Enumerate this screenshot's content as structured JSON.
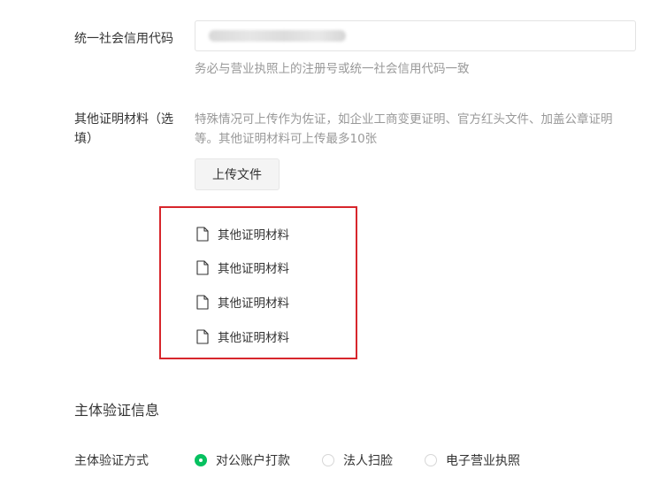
{
  "credit_code": {
    "label": "统一社会信用代码",
    "hint": "务必与营业执照上的注册号或统一社会信用代码一致"
  },
  "other_materials": {
    "label_line1": "其他证明材料（选",
    "label_line2": "填）",
    "hint_line1": "特殊情况可上传作为佐证，如企业工商变更证明、官方红头文件、加盖公章证明",
    "hint_line2": "等。其他证明材料可上传最多10张",
    "upload_button_label": "上传文件",
    "files": [
      {
        "name": "其他证明材料",
        "icon": "file-icon"
      },
      {
        "name": "其他证明材料",
        "icon": "file-icon"
      },
      {
        "name": "其他证明材料",
        "icon": "file-icon"
      },
      {
        "name": "其他证明材料",
        "icon": "file-icon"
      }
    ]
  },
  "verification": {
    "section_title": "主体验证信息",
    "method_label": "主体验证方式",
    "options": [
      {
        "label": "对公账户打款",
        "selected": true
      },
      {
        "label": "法人扫脸",
        "selected": false
      },
      {
        "label": "电子营业执照",
        "selected": false
      }
    ]
  },
  "colors": {
    "accent_green": "#07c160",
    "highlight_red": "#d7262c",
    "hint_gray": "#999999"
  }
}
